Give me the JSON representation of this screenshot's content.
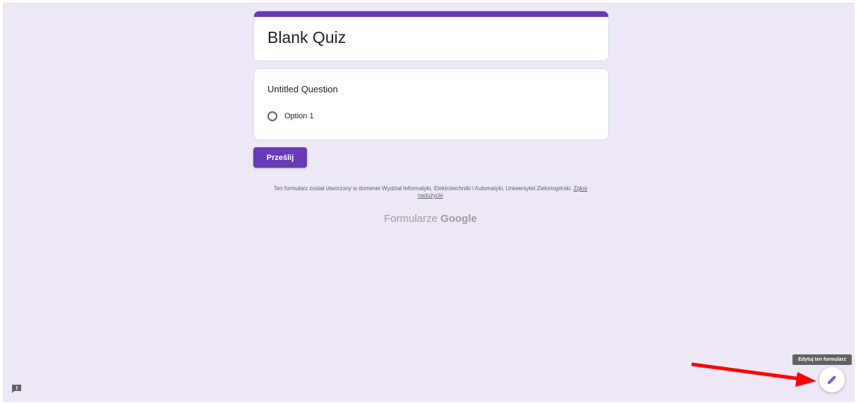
{
  "form": {
    "title": "Blank Quiz",
    "accent_color": "#673ab7",
    "background_color": "#ede7f6"
  },
  "question": {
    "title": "Untitled Question",
    "options": [
      "Option 1"
    ]
  },
  "submit_label": "Prześlij",
  "footer": {
    "text": "Ten formularz został utworzony w domenie Wydział Informatyki, Elektrotechniki i Automatyki, Uniwersytet Zielonogórski.",
    "report_link": "Zgłoś nadużycie"
  },
  "brand": {
    "prefix": "Formularze",
    "name": "Google"
  },
  "edit_tooltip": "Edytuj ten formularz",
  "icons": {
    "feedback": "feedback-icon",
    "edit": "pencil-icon"
  },
  "annotation": {
    "arrow_color": "#ff0000"
  }
}
